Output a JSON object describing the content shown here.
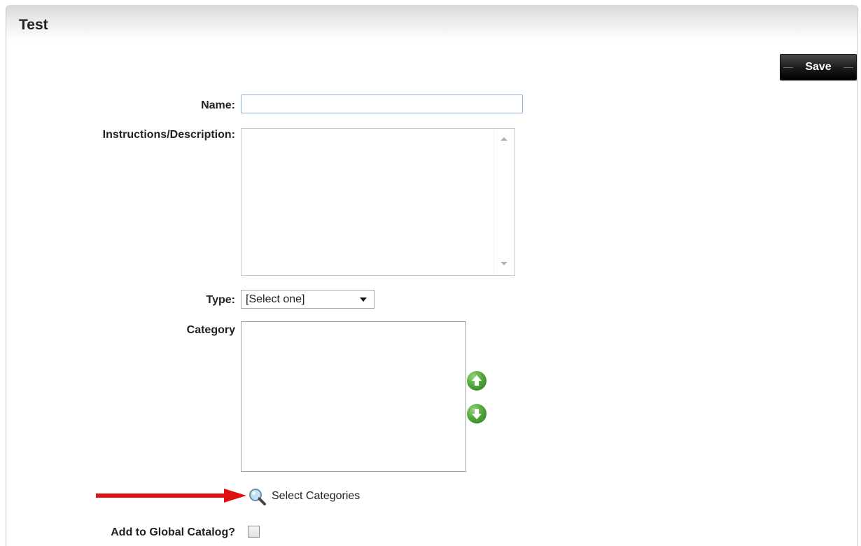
{
  "panel": {
    "title": "Test"
  },
  "toolbar": {
    "save_label": "Save"
  },
  "form": {
    "name_label": "Name:",
    "name_value": "",
    "description_label": "Instructions/Description:",
    "description_value": "",
    "type_label": "Type:",
    "type_selected": "[Select one]",
    "category_label": "Category",
    "select_categories_label": "Select Categories",
    "global_catalog_label": "Add to Global Catalog?",
    "global_catalog_checked": false
  },
  "icons": {
    "move_up": "arrow-up-circle-icon",
    "move_down": "arrow-down-circle-icon",
    "select_categories": "magnifier-icon",
    "annotation": "red-arrow-pointer"
  },
  "colors": {
    "save_button_bg": "#1d1d1d",
    "move_icons": "#52a83a",
    "annotation_arrow": "#e01010",
    "name_field_border": "#8fb3d6"
  }
}
